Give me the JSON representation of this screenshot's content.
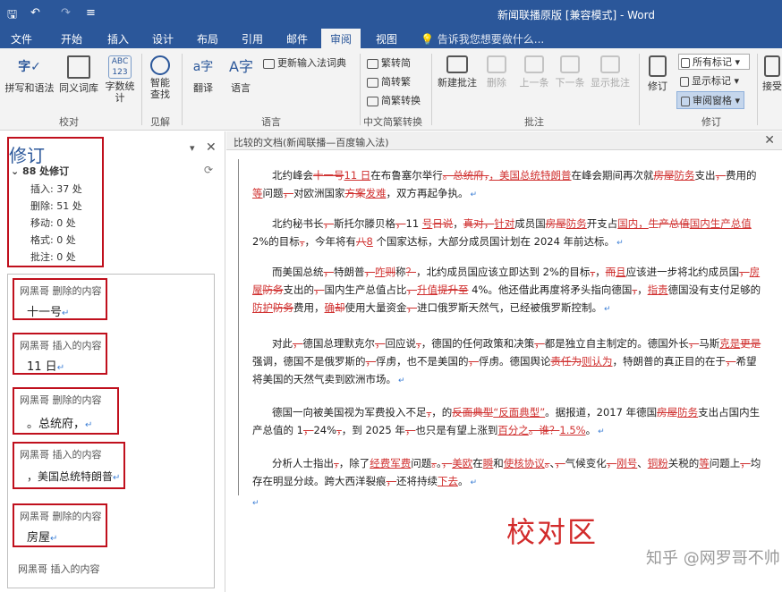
{
  "titlebar": {
    "save_glyph": "🖫",
    "undo_glyph": "↶",
    "redo_glyph": "↷",
    "more_glyph": "≡",
    "title": "新闻联播原版 [兼容模式] - Word"
  },
  "tabs": [
    "文件",
    "开始",
    "插入",
    "设计",
    "布局",
    "引用",
    "邮件",
    "审阅",
    "视图"
  ],
  "active_tab": "审阅",
  "tell_me": "告诉我您想要做什么...",
  "ribbon": {
    "proofing": {
      "spelling": "拼写和语法",
      "thesaurus": "同义词库",
      "word_count": "字数统计",
      "group": "校对"
    },
    "insights": {
      "smart_lookup": "智能查找",
      "group": "见解"
    },
    "language": {
      "translate": "翻译",
      "language": "语言",
      "update_ime": "更新输入法词典",
      "group": "语言"
    },
    "chinese_conv": {
      "to_simplified": "繁转简",
      "to_traditional": "简转繁",
      "convert": "简繁转换",
      "group": "中文简繁转换"
    },
    "comments": {
      "new": "新建批注",
      "delete": "删除",
      "previous": "上一条",
      "next": "下一条",
      "show": "显示批注",
      "group": "批注"
    },
    "tracking": {
      "track": "修订",
      "all_markup": "所有标记",
      "show_markup": "显示标记",
      "reviewing_pane": "审阅窗格",
      "group": "修订"
    },
    "accept": "接受"
  },
  "revision_pane": {
    "title": "修订",
    "total": "88 处修订",
    "stats": [
      "插入: 37 处",
      "删除: 51 处",
      "移动: 0 处",
      "格式: 0 处",
      "批注: 0 处"
    ],
    "cards": [
      {
        "header": "网黑哥 删除的内容",
        "body": "十一号"
      },
      {
        "header": "网黑哥 插入的内容",
        "body": "11 日"
      },
      {
        "header": "网黑哥 删除的内容",
        "body": "。总统府，"
      },
      {
        "header": "网黑哥 插入的内容",
        "body": "，美国总统特朗普"
      },
      {
        "header": "网黑哥 删除的内容",
        "body": "房屋"
      }
    ],
    "tail_header": "网黑哥 插入的内容"
  },
  "compare_pane": {
    "title": "比较的文档(新闻联播—百度输入法)"
  },
  "paragraphs": [
    [
      [
        "n",
        "北约峰会"
      ],
      [
        "d",
        "十一号"
      ],
      [
        "i",
        "11 日"
      ],
      [
        "n",
        "在布鲁塞尔举行"
      ],
      [
        "d",
        "。总统府，"
      ],
      [
        "i",
        "，美国总统特朗普"
      ],
      [
        "n",
        "在峰会期间再次就"
      ],
      [
        "d",
        "房屋"
      ],
      [
        "i",
        "防务"
      ],
      [
        "n",
        "支出"
      ],
      [
        "d",
        "，"
      ],
      [
        "n",
        "费用的"
      ],
      [
        "i",
        "等"
      ],
      [
        "n",
        "问题"
      ],
      [
        "d",
        "，"
      ],
      [
        "n",
        "对欧洲国家"
      ],
      [
        "d",
        "方案"
      ],
      [
        "i",
        "发难"
      ],
      [
        "n",
        "，双方再起争执。"
      ]
    ],
    [
      [
        "n",
        "北约秘书长"
      ],
      [
        "d",
        "，"
      ],
      [
        "n",
        "斯托尔滕贝格"
      ],
      [
        "d",
        "，"
      ],
      [
        "n",
        "11 "
      ],
      [
        "i",
        "号"
      ],
      [
        "d",
        "日说"
      ],
      [
        "n",
        "，"
      ],
      [
        "d",
        "真对，"
      ],
      [
        "i",
        "针对"
      ],
      [
        "n",
        "成员国"
      ],
      [
        "d",
        "房屋"
      ],
      [
        "i",
        "防务"
      ],
      [
        "n",
        "开支占"
      ],
      [
        "i",
        "国内，"
      ],
      [
        "d",
        "生产总值"
      ],
      [
        "i",
        "国内生产总值"
      ],
      [
        "n",
        " 2%的目标"
      ],
      [
        "d",
        "，"
      ],
      [
        "n",
        "，今年将有"
      ],
      [
        "d",
        "八"
      ],
      [
        "i",
        "8"
      ],
      [
        "n",
        " 个国家达标，大部分成员国计划在 2024 年前达标。"
      ]
    ],
    [
      [
        "n",
        "而美国总统"
      ],
      [
        "d",
        "，"
      ],
      [
        "n",
        "特朗普"
      ],
      [
        "d",
        "，"
      ],
      [
        "i",
        "咋"
      ],
      [
        "d",
        "则"
      ],
      [
        "n",
        "称"
      ],
      [
        "d",
        "？"
      ],
      [
        "n",
        "，北约成员国应该立即达到 2%的目标"
      ],
      [
        "d",
        "，"
      ],
      [
        "n",
        "，"
      ],
      [
        "d",
        "而"
      ],
      [
        "i",
        "且"
      ],
      [
        "n",
        "应该进一步将北约成员国"
      ],
      [
        "d",
        "，"
      ],
      [
        "i",
        "房屋"
      ],
      [
        "d",
        "防务"
      ],
      [
        "n",
        "支出的"
      ],
      [
        "d",
        "，"
      ],
      [
        "n",
        "国内生产总值占比"
      ],
      [
        "d",
        "，"
      ],
      [
        "i",
        "升值"
      ],
      [
        "d",
        "提升至"
      ],
      [
        "n",
        " 4%。他还借此再度将矛头指向德国"
      ],
      [
        "d",
        "，"
      ],
      [
        "n",
        "，"
      ],
      [
        "i",
        "指责"
      ],
      [
        "n",
        "德国没有支付足够的"
      ],
      [
        "i",
        "防护"
      ],
      [
        "d",
        "防务"
      ],
      [
        "n",
        "费用，"
      ],
      [
        "i",
        "确"
      ],
      [
        "d",
        "却"
      ],
      [
        "n",
        "使用大量资金"
      ],
      [
        "d",
        "，"
      ],
      [
        "n",
        "进口俄罗斯天然气，已经被俄罗斯控制。"
      ]
    ],
    [
      [
        "n",
        "对此"
      ],
      [
        "d",
        "，"
      ],
      [
        "n",
        "德国总理默克尔"
      ],
      [
        "d",
        "，"
      ],
      [
        "n",
        "回应说"
      ],
      [
        "d",
        "，"
      ],
      [
        "n",
        "，德国的任何政策和决策"
      ],
      [
        "d",
        "，"
      ],
      [
        "n",
        "都是独立自主制定的。德国外长"
      ],
      [
        "d",
        "，"
      ],
      [
        "n",
        "马斯"
      ],
      [
        "i",
        "克是"
      ],
      [
        "d",
        "更是"
      ],
      [
        "n",
        "强调，德国不是俄罗斯的"
      ],
      [
        "d",
        "，"
      ],
      [
        "n",
        "俘虏，也不是美国的"
      ],
      [
        "d",
        "，"
      ],
      [
        "n",
        "俘虏。德国舆论"
      ],
      [
        "d",
        "责任为"
      ],
      [
        "i",
        "则认为"
      ],
      [
        "n",
        "，特朗普的真正目的在于"
      ],
      [
        "d",
        "，"
      ],
      [
        "n",
        "希望将美国的天然气卖到欧洲市场。"
      ]
    ],
    [
      [
        "n",
        "德国一向被美国视为军费投入不足"
      ],
      [
        "d",
        "，"
      ],
      [
        "n",
        "，的"
      ],
      [
        "d",
        "反面典型"
      ],
      [
        "i",
        "“反面典型”"
      ],
      [
        "n",
        "。据报道，2017 年德国"
      ],
      [
        "d",
        "房屋"
      ],
      [
        "i",
        "防务"
      ],
      [
        "n",
        "支出占国内生产总值的 1"
      ],
      [
        "d",
        "，"
      ],
      [
        "n",
        "24%"
      ],
      [
        "d",
        "，"
      ],
      [
        "n",
        "，到 2025 年"
      ],
      [
        "d",
        "，"
      ],
      [
        "n",
        "也只是有望上涨到"
      ],
      [
        "i",
        "百分之"
      ],
      [
        "d",
        "。谁？"
      ],
      [
        "i",
        "1.5%"
      ],
      [
        "n",
        "。"
      ]
    ],
    [
      [
        "n",
        "分析人士指出"
      ],
      [
        "d",
        "，"
      ],
      [
        "n",
        "，除了"
      ],
      [
        "i",
        "经费军费"
      ],
      [
        "n",
        "问题"
      ],
      [
        "d",
        "。"
      ],
      [
        "n",
        "。"
      ],
      [
        "d",
        "，"
      ],
      [
        "i",
        "美欧"
      ],
      [
        "n",
        "在"
      ],
      [
        "i",
        "瞬"
      ],
      [
        "n",
        "和"
      ],
      [
        "i",
        "使核协议"
      ],
      [
        "d",
        "。"
      ],
      [
        "n",
        "、"
      ],
      [
        "d",
        "，"
      ],
      [
        "n",
        "气候变化"
      ],
      [
        "d",
        "，"
      ],
      [
        "i",
        "刚号"
      ],
      [
        "n",
        "、"
      ],
      [
        "i",
        "铜粉"
      ],
      [
        "n",
        "关税的"
      ],
      [
        "i",
        "等"
      ],
      [
        "n",
        "问题上"
      ],
      [
        "d",
        "，"
      ],
      [
        "n",
        "均存在明显分歧。跨大西洋裂痕"
      ],
      [
        "d",
        "，"
      ],
      [
        "n",
        "还将持续"
      ],
      [
        "i",
        "下去"
      ],
      [
        "n",
        "。"
      ]
    ]
  ],
  "stamp_text": "校对区",
  "watermark": "知乎 @网罗哥不帅"
}
